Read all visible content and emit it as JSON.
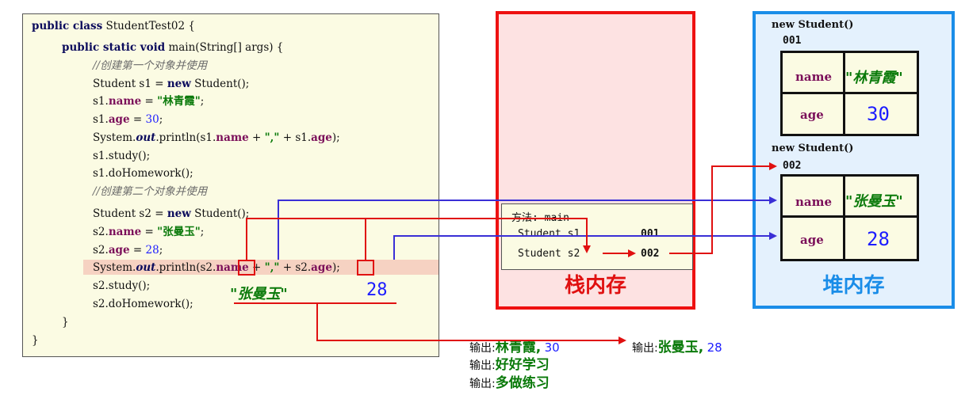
{
  "code": {
    "line1": {
      "kw": "public class",
      "rest": " StudentTest02 {"
    },
    "line2": {
      "kw": "public static void",
      "rest": " main(String[] args) {"
    },
    "comment1": "//创建第一个对象并使用",
    "line4": {
      "a": "Student s1 = ",
      "kw": "new",
      "b": " Student();"
    },
    "line5": {
      "a": "s1.",
      "f": "name",
      "b": " = ",
      "s": "\"林青霞\"",
      "c": ";"
    },
    "line6": {
      "a": "s1.",
      "f": "age",
      "b": " = ",
      "n": "30",
      "c": ";"
    },
    "line7": {
      "a": "System.",
      "st": "out",
      "b": ".println(s1.",
      "f": "name",
      "c": " + ",
      "s": "\",\"",
      "d": " + s1.",
      "f2": "age",
      "e": ");"
    },
    "line8": "s1.study();",
    "line9": "s1.doHomework();",
    "comment2": "//创建第二个对象并使用",
    "line11": {
      "a": "Student s2 = ",
      "kw": "new",
      "b": " Student();"
    },
    "line12": {
      "a": "s2.",
      "f": "name",
      "b": " = ",
      "s": "\"张曼玉\"",
      "c": ";"
    },
    "line13": {
      "a": "s2.",
      "f": "age",
      "b": " = ",
      "n": "28",
      "c": ";"
    },
    "line14": {
      "a": "System.",
      "st": "out",
      "b": ".println(",
      "v1": "s2",
      "c": ".",
      "f": "name",
      "d": " + ",
      "s": "\",\"",
      "e": " + ",
      "v2": "s2",
      "g": ".",
      "f2": "age",
      "h": ");"
    },
    "line15": "s2.study();",
    "line16": "s2.doHomework();",
    "close1": "}",
    "close2": "}"
  },
  "printed": {
    "name": "\"张曼玉\"",
    "age": "28"
  },
  "stack": {
    "title": "栈内存",
    "frame_label": "方法: main",
    "vars": [
      {
        "label": "Student s1",
        "value": "001"
      },
      {
        "label": "Student s2",
        "value": "002"
      }
    ]
  },
  "heap": {
    "title": "堆内存",
    "objects": [
      {
        "header": "new Student()",
        "address": "001",
        "name_label": "name",
        "name_value": "\"林青霞\"",
        "age_label": "age",
        "age_value": "30"
      },
      {
        "header": "new Student()",
        "address": "002",
        "name_label": "name",
        "name_value": "\"张曼玉\"",
        "age_label": "age",
        "age_value": "28"
      }
    ]
  },
  "console": {
    "label": "输出:",
    "lines": [
      {
        "text": "林青霞,",
        "num": "30"
      },
      {
        "text": "好好学习"
      },
      {
        "text": "多做练习"
      }
    ],
    "result": {
      "text": "张曼玉,",
      "num": "28"
    }
  },
  "colors": {
    "stack_border": "#ee1111",
    "heap_border": "#1a8de8",
    "arrow_red": "#e01010",
    "arrow_blue": "#3a2fd6"
  }
}
